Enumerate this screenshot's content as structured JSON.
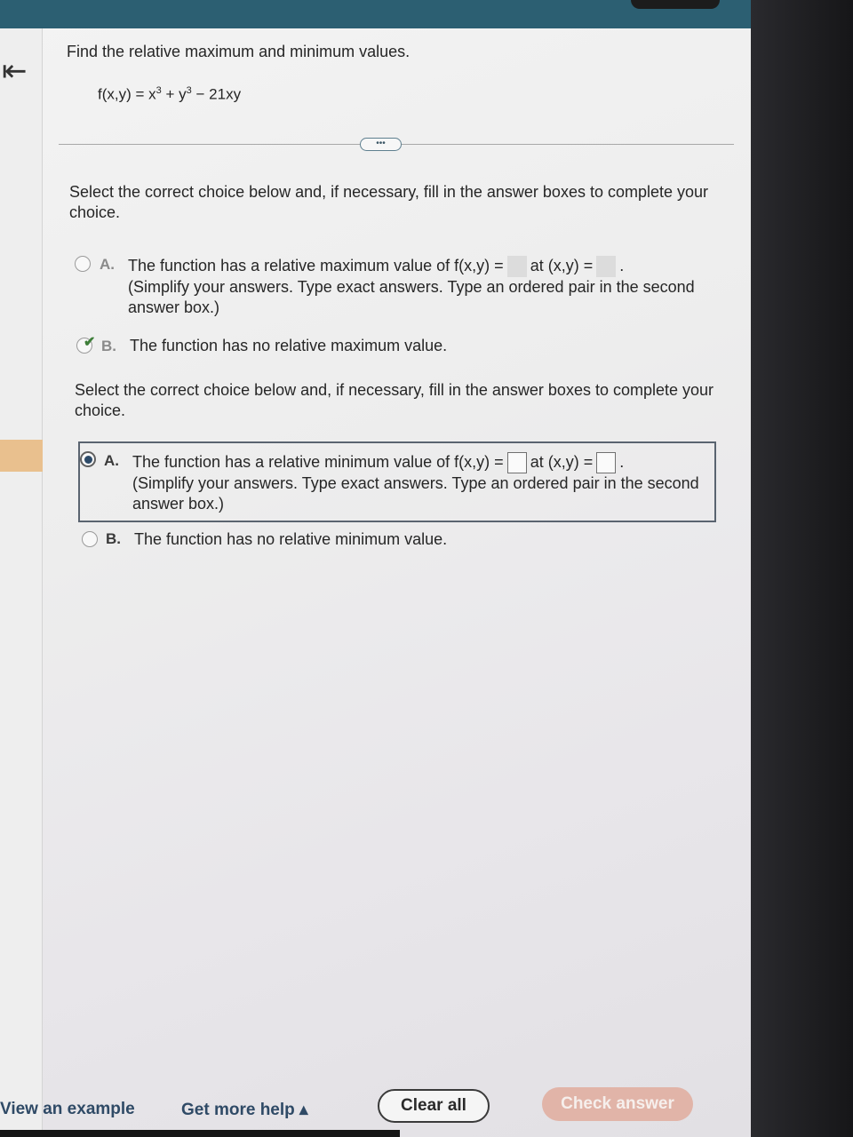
{
  "header": {
    "back_icon": "left-arrow-icon",
    "more_label": "•••"
  },
  "problem": {
    "title": "Find the relative maximum and minimum values.",
    "func_lhs": "f(x,y) = x",
    "func_plus_y": " + y",
    "func_exp": "3",
    "func_rest": " − 21xy"
  },
  "q1": {
    "instruction": "Select the correct choice below and, if necessary, fill in the answer boxes to complete your choice.",
    "option_a": {
      "letter": "A.",
      "text_pre": "The function has a relative maximum value of f(x,y) =",
      "text_mid": "at (x,y) =",
      "text_post": ".",
      "note": "(Simplify your answers. Type exact answers. Type an ordered pair in the second answer box.)",
      "selected": false
    },
    "option_b": {
      "letter": "B.",
      "text": "The function has no relative maximum value.",
      "selected": true,
      "status": "correct"
    }
  },
  "q2": {
    "instruction": "Select the correct choice below and, if necessary, fill in the answer boxes to complete your choice.",
    "option_a": {
      "letter": "A.",
      "text_pre": "The function has a relative minimum value of f(x,y) =",
      "text_mid": "at (x,y) =",
      "text_post": ".",
      "note": "(Simplify your answers. Type exact answers. Type an ordered pair in the second answer box.)",
      "selected": true,
      "min_value": "",
      "min_point": ""
    },
    "option_b": {
      "letter": "B.",
      "text": "The function has no relative minimum value.",
      "selected": false
    }
  },
  "footer": {
    "view_example": "View an example",
    "get_help": "Get more help ▴",
    "clear_all": "Clear all",
    "check_answer": "Check answer"
  },
  "colors": {
    "topbar": "#2c5f72",
    "accent": "#e9c08e",
    "check_button": "#e1b4a8",
    "selected_radio": "#2d4a68",
    "correct": "#3f7f3a"
  }
}
